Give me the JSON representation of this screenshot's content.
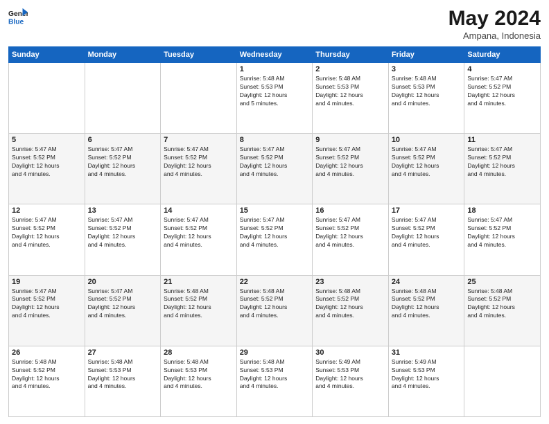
{
  "logo": {
    "line1": "General",
    "line2": "Blue"
  },
  "title": "May 2024",
  "location": "Ampana, Indonesia",
  "days_header": [
    "Sunday",
    "Monday",
    "Tuesday",
    "Wednesday",
    "Thursday",
    "Friday",
    "Saturday"
  ],
  "weeks": [
    [
      {
        "num": "",
        "info": ""
      },
      {
        "num": "",
        "info": ""
      },
      {
        "num": "",
        "info": ""
      },
      {
        "num": "1",
        "info": "Sunrise: 5:48 AM\nSunset: 5:53 PM\nDaylight: 12 hours\nand 5 minutes."
      },
      {
        "num": "2",
        "info": "Sunrise: 5:48 AM\nSunset: 5:53 PM\nDaylight: 12 hours\nand 4 minutes."
      },
      {
        "num": "3",
        "info": "Sunrise: 5:48 AM\nSunset: 5:53 PM\nDaylight: 12 hours\nand 4 minutes."
      },
      {
        "num": "4",
        "info": "Sunrise: 5:47 AM\nSunset: 5:52 PM\nDaylight: 12 hours\nand 4 minutes."
      }
    ],
    [
      {
        "num": "5",
        "info": "Sunrise: 5:47 AM\nSunset: 5:52 PM\nDaylight: 12 hours\nand 4 minutes."
      },
      {
        "num": "6",
        "info": "Sunrise: 5:47 AM\nSunset: 5:52 PM\nDaylight: 12 hours\nand 4 minutes."
      },
      {
        "num": "7",
        "info": "Sunrise: 5:47 AM\nSunset: 5:52 PM\nDaylight: 12 hours\nand 4 minutes."
      },
      {
        "num": "8",
        "info": "Sunrise: 5:47 AM\nSunset: 5:52 PM\nDaylight: 12 hours\nand 4 minutes."
      },
      {
        "num": "9",
        "info": "Sunrise: 5:47 AM\nSunset: 5:52 PM\nDaylight: 12 hours\nand 4 minutes."
      },
      {
        "num": "10",
        "info": "Sunrise: 5:47 AM\nSunset: 5:52 PM\nDaylight: 12 hours\nand 4 minutes."
      },
      {
        "num": "11",
        "info": "Sunrise: 5:47 AM\nSunset: 5:52 PM\nDaylight: 12 hours\nand 4 minutes."
      }
    ],
    [
      {
        "num": "12",
        "info": "Sunrise: 5:47 AM\nSunset: 5:52 PM\nDaylight: 12 hours\nand 4 minutes."
      },
      {
        "num": "13",
        "info": "Sunrise: 5:47 AM\nSunset: 5:52 PM\nDaylight: 12 hours\nand 4 minutes."
      },
      {
        "num": "14",
        "info": "Sunrise: 5:47 AM\nSunset: 5:52 PM\nDaylight: 12 hours\nand 4 minutes."
      },
      {
        "num": "15",
        "info": "Sunrise: 5:47 AM\nSunset: 5:52 PM\nDaylight: 12 hours\nand 4 minutes."
      },
      {
        "num": "16",
        "info": "Sunrise: 5:47 AM\nSunset: 5:52 PM\nDaylight: 12 hours\nand 4 minutes."
      },
      {
        "num": "17",
        "info": "Sunrise: 5:47 AM\nSunset: 5:52 PM\nDaylight: 12 hours\nand 4 minutes."
      },
      {
        "num": "18",
        "info": "Sunrise: 5:47 AM\nSunset: 5:52 PM\nDaylight: 12 hours\nand 4 minutes."
      }
    ],
    [
      {
        "num": "19",
        "info": "Sunrise: 5:47 AM\nSunset: 5:52 PM\nDaylight: 12 hours\nand 4 minutes."
      },
      {
        "num": "20",
        "info": "Sunrise: 5:47 AM\nSunset: 5:52 PM\nDaylight: 12 hours\nand 4 minutes."
      },
      {
        "num": "21",
        "info": "Sunrise: 5:48 AM\nSunset: 5:52 PM\nDaylight: 12 hours\nand 4 minutes."
      },
      {
        "num": "22",
        "info": "Sunrise: 5:48 AM\nSunset: 5:52 PM\nDaylight: 12 hours\nand 4 minutes."
      },
      {
        "num": "23",
        "info": "Sunrise: 5:48 AM\nSunset: 5:52 PM\nDaylight: 12 hours\nand 4 minutes."
      },
      {
        "num": "24",
        "info": "Sunrise: 5:48 AM\nSunset: 5:52 PM\nDaylight: 12 hours\nand 4 minutes."
      },
      {
        "num": "25",
        "info": "Sunrise: 5:48 AM\nSunset: 5:52 PM\nDaylight: 12 hours\nand 4 minutes."
      }
    ],
    [
      {
        "num": "26",
        "info": "Sunrise: 5:48 AM\nSunset: 5:52 PM\nDaylight: 12 hours\nand 4 minutes."
      },
      {
        "num": "27",
        "info": "Sunrise: 5:48 AM\nSunset: 5:53 PM\nDaylight: 12 hours\nand 4 minutes."
      },
      {
        "num": "28",
        "info": "Sunrise: 5:48 AM\nSunset: 5:53 PM\nDaylight: 12 hours\nand 4 minutes."
      },
      {
        "num": "29",
        "info": "Sunrise: 5:48 AM\nSunset: 5:53 PM\nDaylight: 12 hours\nand 4 minutes."
      },
      {
        "num": "30",
        "info": "Sunrise: 5:49 AM\nSunset: 5:53 PM\nDaylight: 12 hours\nand 4 minutes."
      },
      {
        "num": "31",
        "info": "Sunrise: 5:49 AM\nSunset: 5:53 PM\nDaylight: 12 hours\nand 4 minutes."
      },
      {
        "num": "",
        "info": ""
      }
    ]
  ]
}
